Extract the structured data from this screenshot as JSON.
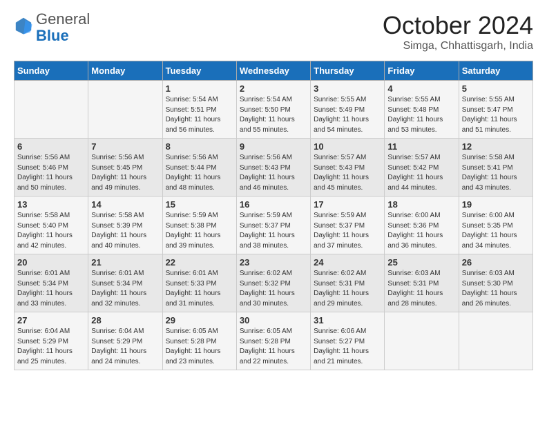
{
  "header": {
    "logo_general": "General",
    "logo_blue": "Blue",
    "month_title": "October 2024",
    "location": "Simga, Chhattisgarh, India"
  },
  "days_of_week": [
    "Sunday",
    "Monday",
    "Tuesday",
    "Wednesday",
    "Thursday",
    "Friday",
    "Saturday"
  ],
  "weeks": [
    [
      {
        "day": "",
        "info": ""
      },
      {
        "day": "",
        "info": ""
      },
      {
        "day": "1",
        "info": "Sunrise: 5:54 AM\nSunset: 5:51 PM\nDaylight: 11 hours and 56 minutes."
      },
      {
        "day": "2",
        "info": "Sunrise: 5:54 AM\nSunset: 5:50 PM\nDaylight: 11 hours and 55 minutes."
      },
      {
        "day": "3",
        "info": "Sunrise: 5:55 AM\nSunset: 5:49 PM\nDaylight: 11 hours and 54 minutes."
      },
      {
        "day": "4",
        "info": "Sunrise: 5:55 AM\nSunset: 5:48 PM\nDaylight: 11 hours and 53 minutes."
      },
      {
        "day": "5",
        "info": "Sunrise: 5:55 AM\nSunset: 5:47 PM\nDaylight: 11 hours and 51 minutes."
      }
    ],
    [
      {
        "day": "6",
        "info": "Sunrise: 5:56 AM\nSunset: 5:46 PM\nDaylight: 11 hours and 50 minutes."
      },
      {
        "day": "7",
        "info": "Sunrise: 5:56 AM\nSunset: 5:45 PM\nDaylight: 11 hours and 49 minutes."
      },
      {
        "day": "8",
        "info": "Sunrise: 5:56 AM\nSunset: 5:44 PM\nDaylight: 11 hours and 48 minutes."
      },
      {
        "day": "9",
        "info": "Sunrise: 5:56 AM\nSunset: 5:43 PM\nDaylight: 11 hours and 46 minutes."
      },
      {
        "day": "10",
        "info": "Sunrise: 5:57 AM\nSunset: 5:43 PM\nDaylight: 11 hours and 45 minutes."
      },
      {
        "day": "11",
        "info": "Sunrise: 5:57 AM\nSunset: 5:42 PM\nDaylight: 11 hours and 44 minutes."
      },
      {
        "day": "12",
        "info": "Sunrise: 5:58 AM\nSunset: 5:41 PM\nDaylight: 11 hours and 43 minutes."
      }
    ],
    [
      {
        "day": "13",
        "info": "Sunrise: 5:58 AM\nSunset: 5:40 PM\nDaylight: 11 hours and 42 minutes."
      },
      {
        "day": "14",
        "info": "Sunrise: 5:58 AM\nSunset: 5:39 PM\nDaylight: 11 hours and 40 minutes."
      },
      {
        "day": "15",
        "info": "Sunrise: 5:59 AM\nSunset: 5:38 PM\nDaylight: 11 hours and 39 minutes."
      },
      {
        "day": "16",
        "info": "Sunrise: 5:59 AM\nSunset: 5:37 PM\nDaylight: 11 hours and 38 minutes."
      },
      {
        "day": "17",
        "info": "Sunrise: 5:59 AM\nSunset: 5:37 PM\nDaylight: 11 hours and 37 minutes."
      },
      {
        "day": "18",
        "info": "Sunrise: 6:00 AM\nSunset: 5:36 PM\nDaylight: 11 hours and 36 minutes."
      },
      {
        "day": "19",
        "info": "Sunrise: 6:00 AM\nSunset: 5:35 PM\nDaylight: 11 hours and 34 minutes."
      }
    ],
    [
      {
        "day": "20",
        "info": "Sunrise: 6:01 AM\nSunset: 5:34 PM\nDaylight: 11 hours and 33 minutes."
      },
      {
        "day": "21",
        "info": "Sunrise: 6:01 AM\nSunset: 5:34 PM\nDaylight: 11 hours and 32 minutes."
      },
      {
        "day": "22",
        "info": "Sunrise: 6:01 AM\nSunset: 5:33 PM\nDaylight: 11 hours and 31 minutes."
      },
      {
        "day": "23",
        "info": "Sunrise: 6:02 AM\nSunset: 5:32 PM\nDaylight: 11 hours and 30 minutes."
      },
      {
        "day": "24",
        "info": "Sunrise: 6:02 AM\nSunset: 5:31 PM\nDaylight: 11 hours and 29 minutes."
      },
      {
        "day": "25",
        "info": "Sunrise: 6:03 AM\nSunset: 5:31 PM\nDaylight: 11 hours and 28 minutes."
      },
      {
        "day": "26",
        "info": "Sunrise: 6:03 AM\nSunset: 5:30 PM\nDaylight: 11 hours and 26 minutes."
      }
    ],
    [
      {
        "day": "27",
        "info": "Sunrise: 6:04 AM\nSunset: 5:29 PM\nDaylight: 11 hours and 25 minutes."
      },
      {
        "day": "28",
        "info": "Sunrise: 6:04 AM\nSunset: 5:29 PM\nDaylight: 11 hours and 24 minutes."
      },
      {
        "day": "29",
        "info": "Sunrise: 6:05 AM\nSunset: 5:28 PM\nDaylight: 11 hours and 23 minutes."
      },
      {
        "day": "30",
        "info": "Sunrise: 6:05 AM\nSunset: 5:28 PM\nDaylight: 11 hours and 22 minutes."
      },
      {
        "day": "31",
        "info": "Sunrise: 6:06 AM\nSunset: 5:27 PM\nDaylight: 11 hours and 21 minutes."
      },
      {
        "day": "",
        "info": ""
      },
      {
        "day": "",
        "info": ""
      }
    ]
  ]
}
